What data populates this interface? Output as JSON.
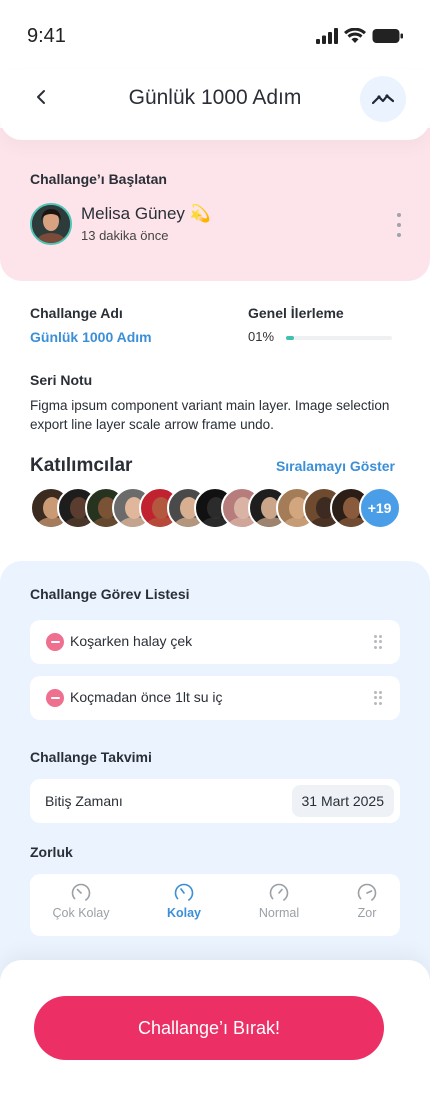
{
  "status": {
    "time": "9:41"
  },
  "header": {
    "title": "Günlük 1000 Adım"
  },
  "initiator": {
    "label": "Challange’ı Başlatan",
    "name": "Melisa Güney 💫",
    "time_ago": "13 dakika önce"
  },
  "info": {
    "name_label": "Challange Adı",
    "name_value": "Günlük 1000 Adım",
    "progress_label": "Genel İlerleme",
    "progress_text": "01%",
    "progress_fraction": 0.08,
    "note_label": "Seri Notu",
    "note_text": "Figma ipsum component variant main layer. Image selection export line layer scale arrow frame undo."
  },
  "participants": {
    "title": "Katılımcılar",
    "ranking_link": "Sıralamayı Göster",
    "more_count": "+19",
    "avatar_colors": [
      [
        "#c99a73",
        "#3a2a20"
      ],
      [
        "#5a3d2e",
        "#1d1d1d"
      ],
      [
        "#7a5236",
        "#26331e"
      ],
      [
        "#e0b79a",
        "#6b6b6b"
      ],
      [
        "#b3573e",
        "#c0222f"
      ],
      [
        "#d8b091",
        "#4a4a4a"
      ],
      [
        "#2b2b2b",
        "#111111"
      ],
      [
        "#d9b4a4",
        "#b77c7c"
      ],
      [
        "#caa58a",
        "#1e1e1e"
      ],
      [
        "#d2a780",
        "#a47c57"
      ],
      [
        "#3d2a20",
        "#6e4a2e"
      ],
      [
        "#8a5a3c",
        "#2a1e16"
      ]
    ]
  },
  "tasks": {
    "label": "Challange Görev Listesi",
    "items": [
      "Koşarken halay çek",
      "Koçmadan önce 1lt su iç"
    ]
  },
  "calendar": {
    "label": "Challange Takvimi",
    "end_label": "Bitiş Zamanı",
    "end_value": "31 Mart 2025"
  },
  "difficulty": {
    "label": "Zorluk",
    "options": [
      "Çok Kolay",
      "Kolay",
      "Normal",
      "Zor"
    ],
    "selected": "Kolay"
  },
  "actions": {
    "leave": "Challange’ı Bırak!"
  },
  "colors": {
    "accent": "#3b8fd8",
    "primary_button": "#ec2f64",
    "progress": "#3fc1b0",
    "pink_panel": "#fde4ea",
    "blue_panel": "#eaf3fe"
  }
}
